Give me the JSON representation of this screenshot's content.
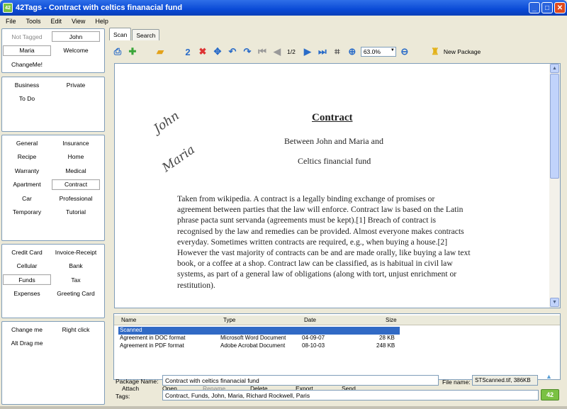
{
  "window": {
    "title": "42Tags - Contract with celtics finanacial fund",
    "icon_text": "42"
  },
  "menu": [
    "File",
    "Tools",
    "Edit",
    "View",
    "Help"
  ],
  "tag_groups": [
    {
      "tags": [
        {
          "label": "Not Tagged",
          "state": "dim"
        },
        {
          "label": "John",
          "state": "selected"
        },
        {
          "label": "Maria",
          "state": "selected"
        },
        {
          "label": "Welcome",
          "state": ""
        },
        {
          "label": "ChangeMe!",
          "state": ""
        }
      ]
    },
    {
      "tags": [
        {
          "label": "Business",
          "state": ""
        },
        {
          "label": "Private",
          "state": ""
        },
        {
          "label": "To Do",
          "state": ""
        }
      ]
    },
    {
      "tags": [
        {
          "label": "General",
          "state": ""
        },
        {
          "label": "Insurance",
          "state": ""
        },
        {
          "label": "Recipe",
          "state": ""
        },
        {
          "label": "Home",
          "state": ""
        },
        {
          "label": "Warranty",
          "state": ""
        },
        {
          "label": "Medical",
          "state": ""
        },
        {
          "label": "Apartment",
          "state": ""
        },
        {
          "label": "Contract",
          "state": "selected"
        },
        {
          "label": "Car",
          "state": ""
        },
        {
          "label": "Professional",
          "state": ""
        },
        {
          "label": "Temporary",
          "state": ""
        },
        {
          "label": "Tutorial",
          "state": ""
        }
      ]
    },
    {
      "tags": [
        {
          "label": "Credit Card",
          "state": ""
        },
        {
          "label": "Invoice-Receipt",
          "state": ""
        },
        {
          "label": "Cellular",
          "state": ""
        },
        {
          "label": "Bank",
          "state": ""
        },
        {
          "label": "Funds",
          "state": "selected"
        },
        {
          "label": "Tax",
          "state": ""
        },
        {
          "label": "Expenses",
          "state": ""
        },
        {
          "label": "Greeting Card",
          "state": ""
        }
      ]
    },
    {
      "tags": [
        {
          "label": "Change me",
          "state": ""
        },
        {
          "label": "Right click",
          "state": ""
        },
        {
          "label": "Alt Drag me",
          "state": ""
        }
      ]
    }
  ],
  "tabs": [
    "Scan",
    "Search"
  ],
  "toolbar": {
    "page_indicator": "1/2",
    "zoom": "63.0%",
    "new_package": "New Package"
  },
  "document": {
    "handwriting": [
      "John",
      "Maria"
    ],
    "title": "Contract",
    "line1": "Between John and Maria and",
    "line2": "Celtics financial fund",
    "body": [
      "Taken from wikipedia. A contract is a legally binding exchange of promises or",
      "agreement between parties that the law will enforce. Contract law is based on the Latin",
      "phrase pacta sunt servanda (agreements must be kept).[1] Breach of contract is",
      "recognised by the law and remedies can be provided. Almost everyone makes contracts",
      "everyday. Sometimes written contracts are required, e.g., when buying a house.[2]",
      "However the vast majority of contracts can be and are made orally, like buying a law text",
      "book, or a coffee at a shop. Contract law can be classified, as is habitual in civil law",
      "systems, as part of a general law of obligations (along with tort, unjust enrichment or",
      "restitution)."
    ]
  },
  "files": {
    "columns": [
      "Name",
      "Type",
      "Date",
      "Size"
    ],
    "selected_row": "Scanned",
    "rows": [
      {
        "name": "Agreement in DOC format",
        "type": "Microsoft Word Document",
        "date": "04-09-07",
        "size": "28 KB"
      },
      {
        "name": "Agreement in PDF format",
        "type": "Adobe Acrobat Document",
        "date": "08-10-03",
        "size": "248 KB"
      }
    ]
  },
  "actions": [
    "Attach",
    "Open",
    "Rename",
    "Delete",
    "Export",
    "Send"
  ],
  "package": {
    "name_label": "Package Name:",
    "name_value": "Contract with celtics finanacial fund",
    "file_label": "File name:",
    "file_value": "STScanned.tif, 386KB",
    "tags_label": "Tags:",
    "tags_value": "Contract, Funds, John, Maria, Richard Rockwell, Paris"
  },
  "colors": {
    "titlebar": "#0a4ad6",
    "selection": "#316ac5",
    "accent_green": "#7ac143"
  }
}
